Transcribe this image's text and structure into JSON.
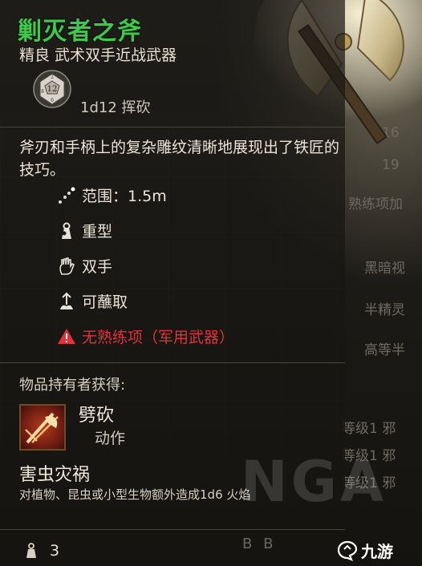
{
  "item": {
    "name": "剿灭者之斧",
    "subtitle": "精良 武术双手近战武器",
    "damage_die": "12",
    "damage_die_small_top": "2",
    "damage_die_small_left": "8",
    "damage_die_small_bottom": "6",
    "damage_roll": "1d12 挥砍",
    "description": "斧刃和手柄上的复杂雕纹清晰地展现出了铁匠的技巧。",
    "properties": [
      {
        "icon": "range-icon",
        "label": "范围：1.5m"
      },
      {
        "icon": "heavy-icon",
        "label": "重型"
      },
      {
        "icon": "two-handed-icon",
        "label": "双手"
      },
      {
        "icon": "dippable-icon",
        "label": "可蘸取"
      },
      {
        "icon": "warning-icon",
        "label": "无熟练项（军用武器）",
        "color": "#e0323a"
      }
    ],
    "owner_gains_label": "物品持有者获得:",
    "skill": {
      "name": "劈砍",
      "type": "动作"
    },
    "bane": {
      "title": "害虫灾祸",
      "description": "对植物、昆虫或小型生物额外造成1d6 火焰"
    },
    "weight": "3"
  },
  "side_panel": {
    "lines": [
      "16",
      "19",
      "熟练项加",
      "黑暗视",
      "半精灵",
      "高等半",
      "等级1 邪",
      "等级1 邪",
      "等级1 邪"
    ]
  },
  "watermark": {
    "text": "NGA",
    "bb": "B B",
    "logo": "九游"
  },
  "colors": {
    "title": "#3ec94b",
    "warning": "#e0323a"
  }
}
